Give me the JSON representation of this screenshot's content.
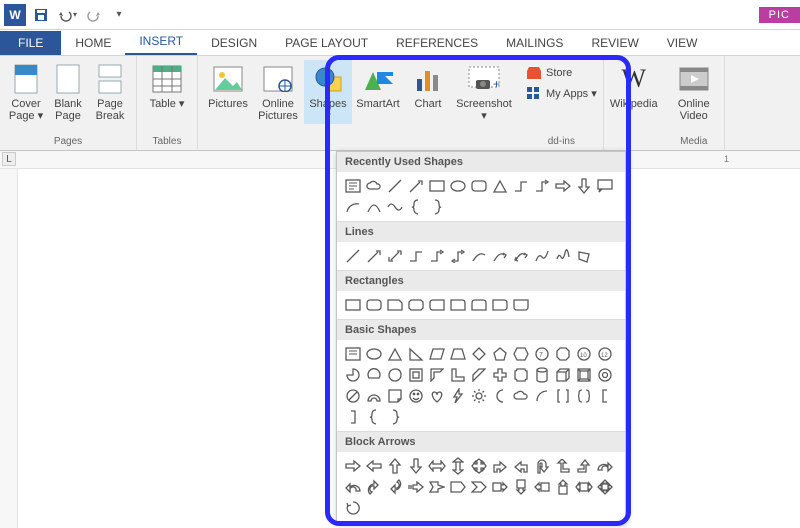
{
  "titlebar": {
    "app_letter": "W",
    "pic_tab": "PIC"
  },
  "qat": {
    "save": "save-icon",
    "undo": "undo-icon",
    "redo": "redo-icon"
  },
  "tabs": {
    "file": "FILE",
    "home": "HOME",
    "insert": "INSERT",
    "design": "DESIGN",
    "page_layout": "PAGE LAYOUT",
    "references": "REFERENCES",
    "mailings": "MAILINGS",
    "review": "REVIEW",
    "view": "VIEW"
  },
  "ribbon": {
    "pages": {
      "cover": "Cover Page ▾",
      "blank": "Blank Page",
      "break": "Page Break",
      "label": "Pages"
    },
    "tables": {
      "table": "Table ▾",
      "label": "Tables"
    },
    "illus": {
      "pictures": "Pictures",
      "online": "Online Pictures",
      "shapes": "Shapes ▾",
      "smartart": "SmartArt",
      "chart": "Chart",
      "screenshot": "Screenshot ▾"
    },
    "addins": {
      "store": "Store",
      "myapps": "My Apps ▾",
      "wikipedia": "Wikipedia",
      "label": "dd-ins"
    },
    "media": {
      "video": "Online Video",
      "label": "Media"
    }
  },
  "shapes_menu": {
    "recent": "Recently Used Shapes",
    "lines": "Lines",
    "rectangles": "Rectangles",
    "basic": "Basic Shapes",
    "block": "Block Arrows"
  },
  "ruler": {
    "one": "1",
    "L": "L"
  }
}
